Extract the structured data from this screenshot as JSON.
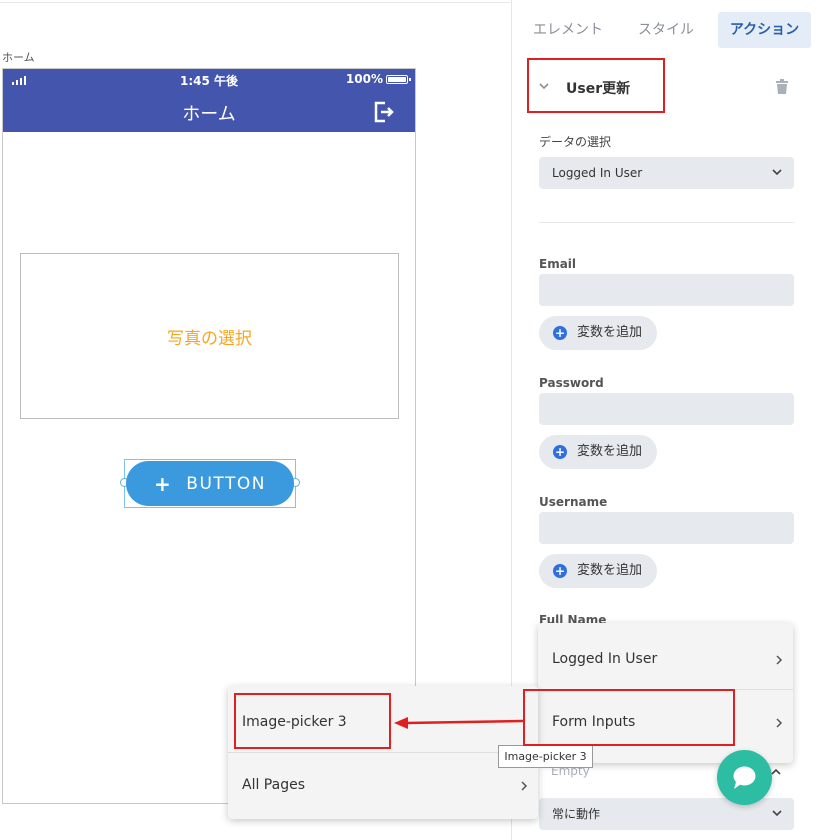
{
  "canvas": {
    "screen_label": "ホーム",
    "status_time": "1:45 午後",
    "status_battery": "100%",
    "appbar_title": "ホーム",
    "photo_picker_text": "写真の選択",
    "button_label": "BUTTON",
    "button_icon": "plus-icon"
  },
  "panel": {
    "tabs": [
      {
        "label": "エレメント"
      },
      {
        "label": "スタイル"
      },
      {
        "label": "アクション"
      }
    ],
    "action_title": "User更新",
    "data_select_label": "データの選択",
    "data_select_value": "Logged In User",
    "fields": [
      {
        "label": "Email",
        "add_variable": "変数を追加"
      },
      {
        "label": "Password",
        "add_variable": "変数を追加"
      },
      {
        "label": "Username",
        "add_variable": "変数を追加"
      },
      {
        "label": "Full Name"
      }
    ],
    "empty_placeholder": "Empty",
    "run_condition_value": "常に動作"
  },
  "menus": {
    "source_menu": [
      {
        "label": "Logged In User"
      },
      {
        "label": "Form Inputs"
      }
    ],
    "sub_menu": [
      {
        "label": "Image-picker 3"
      },
      {
        "label": "All Pages"
      }
    ],
    "tooltip": "Image-picker 3"
  },
  "colors": {
    "appbar": "#4355ad",
    "button": "#3b99de",
    "photo_text": "#f5a623",
    "active_tab_bg": "#e3ecf7",
    "highlight": "#e02020",
    "chat": "#2dbda3"
  }
}
